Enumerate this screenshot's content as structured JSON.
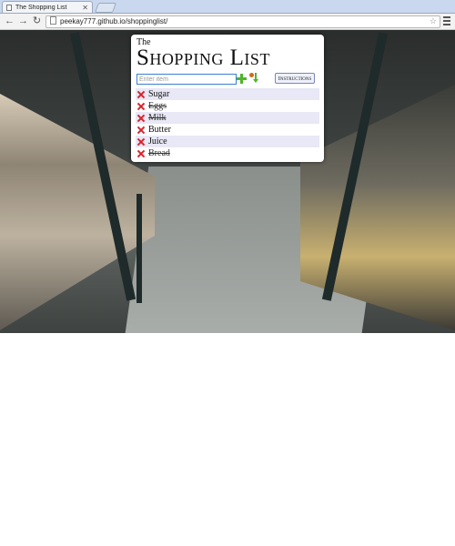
{
  "browser": {
    "tab_title": "The Shopping List",
    "url": "peekay777.github.io/shoppinglist/"
  },
  "app": {
    "kicker": "The",
    "title": "Shopping List",
    "input_placeholder": "Enter item",
    "instructions_label": "Instructions"
  },
  "items": [
    {
      "label": "Sugar",
      "done": false
    },
    {
      "label": "Eggs",
      "done": true
    },
    {
      "label": "Milk",
      "done": true
    },
    {
      "label": "Butter",
      "done": false
    },
    {
      "label": "Juice",
      "done": false
    },
    {
      "label": "Bread",
      "done": true
    }
  ],
  "colors": {
    "accent_blue": "#3b7fd0",
    "add_green": "#4fb52a",
    "delete_red": "#d9232b",
    "row_shade": "#e8e8f6"
  }
}
